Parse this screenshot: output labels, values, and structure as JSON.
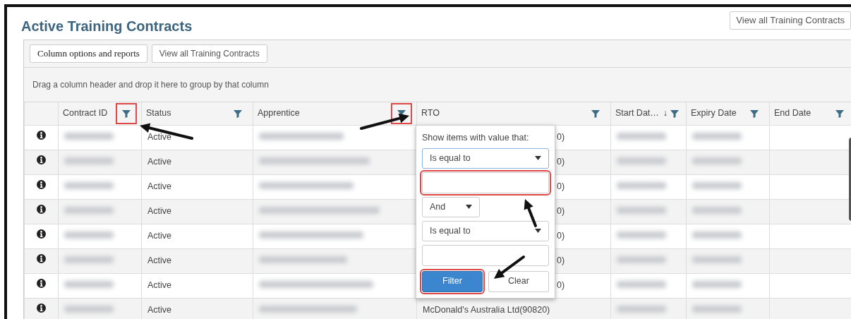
{
  "page": {
    "title": "Active Training Contracts",
    "top_button": "View all Training Contracts"
  },
  "toolbar": {
    "buttons": [
      "Column options and reports",
      "View all Training Contracts"
    ]
  },
  "group_hint": "Drag a column header and drop it here to group by that column",
  "table": {
    "columns": [
      {
        "label": "Contract ID",
        "highlighted": true
      },
      {
        "label": "Status",
        "highlighted": false
      },
      {
        "label": "Apprentice",
        "highlighted": true
      },
      {
        "label": "RTO",
        "highlighted": false
      },
      {
        "label": "Start Dat…",
        "sort_icon": "↓",
        "highlighted": false
      },
      {
        "label": "Expiry Date",
        "highlighted": false
      },
      {
        "label": "End Date",
        "highlighted": false
      }
    ],
    "rows": [
      {
        "status": "Active",
        "rto": "0)"
      },
      {
        "status": "Active",
        "rto": "0)"
      },
      {
        "status": "Active",
        "rto": "0)"
      },
      {
        "status": "Active",
        "rto": "0)"
      },
      {
        "status": "Active",
        "rto": "0)"
      },
      {
        "status": "Active",
        "rto": "0)"
      },
      {
        "status": "Active",
        "rto": "0)"
      },
      {
        "status": "Active",
        "rto": "McDonald's Australia Ltd(90820)"
      }
    ]
  },
  "filter_menu": {
    "label": "Show items with value that:",
    "operator_1": {
      "value": "Is equal to",
      "focused": true
    },
    "value_1": {
      "highlighted": true
    },
    "logic": "And",
    "operator_2": {
      "value": "Is equal to",
      "focused": false
    },
    "value_2": {
      "highlighted": false
    },
    "buttons": [
      {
        "label": "Filter",
        "kind": "primary",
        "highlighted": true
      },
      {
        "label": "Clear",
        "kind": "secondary",
        "highlighted": false
      }
    ]
  }
}
